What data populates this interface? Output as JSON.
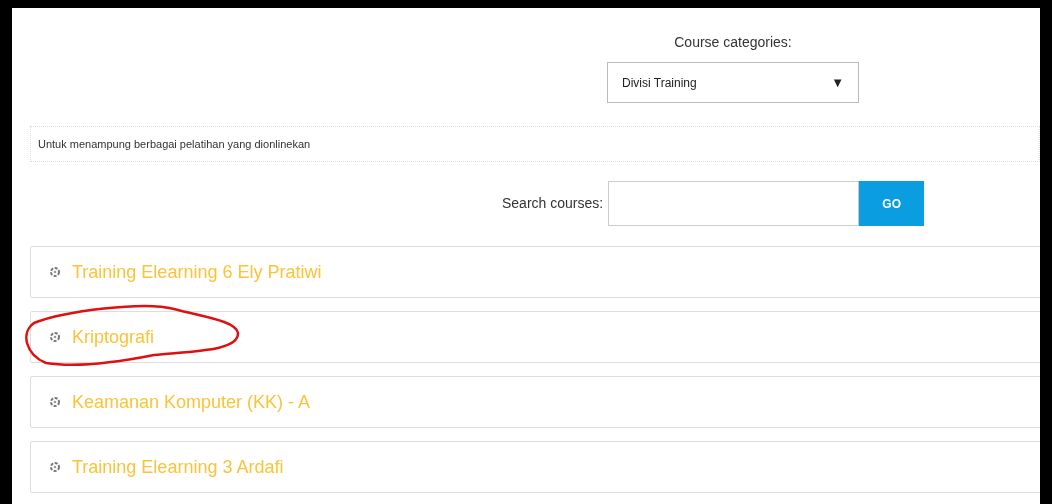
{
  "categories": {
    "label": "Course categories:",
    "value": "Divisi Training",
    "arrow": "▼"
  },
  "description": "Untuk menampung berbagai pelatihan yang dionlinekan",
  "search": {
    "label": "Search courses:",
    "button": "GO"
  },
  "courses": [
    {
      "title": "Training Elearning 6 Ely Pratiwi",
      "circled": false
    },
    {
      "title": "Kriptografi",
      "circled": true
    },
    {
      "title": "Keamanan Komputer (KK) - A",
      "circled": false
    },
    {
      "title": "Training Elearning 3 Ardafi",
      "circled": false
    }
  ]
}
